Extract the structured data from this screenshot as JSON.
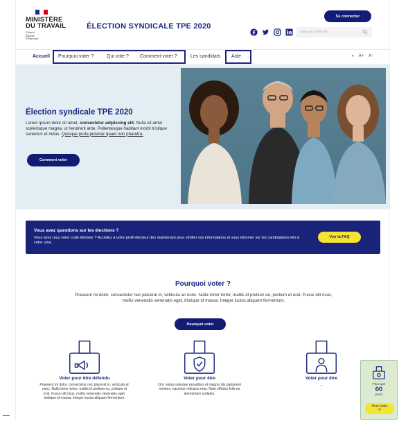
{
  "header": {
    "ministry_line1": "MINISTÈRE",
    "ministry_line2": "DU TRAVAIL",
    "motto": [
      "Liberté",
      "Égalité",
      "Fraternité"
    ],
    "site_title": "ÉLECTION SYNDICALE TPE 2020",
    "login_label": "Se connecter",
    "search_placeholder": "Ainsi une recherche",
    "socials": [
      "facebook-icon",
      "twitter-icon",
      "instagram-icon",
      "linkedin-icon"
    ]
  },
  "nav": {
    "items": [
      "Accueil",
      "Pourquoi voter ?",
      "Qui vote ?",
      "Comment voter ?",
      "Les candidats",
      "Aide"
    ],
    "tools": [
      "◑",
      "A+",
      "A-"
    ]
  },
  "hero": {
    "title": "Élection syndicale TPE 2020",
    "text_1": "Lorem ipsum dolor sit amet, ",
    "text_bold": "consectetur adipiscing elit.",
    "text_2": " Nulla sit amet scelerisque magna, ut hendrerit ante. Pellentesque ",
    "text_italic": "habitant morbi tristique senectus",
    "text_3": " et netus. ",
    "text_link": "Quisque porta pulvinar quam non pharetra.",
    "button_label": "Comment voter"
  },
  "banner": {
    "title": "Vous avez questions sur les élections ?",
    "text": "Vous avez reçu votre code électeur ? Accédez à votre profil électeur dès maintenant pour vérifier vos informations et vous informer sur les candidatures liés à votre urne.",
    "button_label": "Voir la FAQ"
  },
  "why": {
    "title": "Pourquoi voter ?",
    "text": "Praesent mi dolor, consectetur nec placerat in, vehicula ac nunc. Nulla tortor tortor, mattis id pretium eu, pretium et erat. Fusce elit risus, mollis venenatis venenatis eget, tristique id massa. Integer luctus aliquam fermentum.",
    "button_label": "Pourquoi voter",
    "cards": [
      {
        "title": "Voter pour être défendu",
        "text": "Praesent mi dolor, consectetur nec placerat in, vehicula ac nunc. Nulla tortor tortor, mattis id pretium eu, pretium et erat. Fusce elit risus, mollis venenatis venenatis eget, tristique id massa. Integer luctus aliquam fermentum."
      },
      {
        "title": "Voter pour être",
        "text": "Orci varius natoque penatibus et magnis dis parturient montes, nascetur ridiculus mus. Nam efficitur felis eu elementum sodales."
      },
      {
        "title": "Voter pour être",
        "text": "..."
      }
    ]
  },
  "countdown": {
    "label": "Plus que",
    "days": "00",
    "unit": "jours",
    "button_line1": "Pour voter",
    "button_line2": "↺"
  },
  "colors": {
    "primary": "#121c72",
    "accent_yellow": "#f7e333",
    "hero_bg": "#e2eef3",
    "countdown_bg": "#dcebd0"
  }
}
